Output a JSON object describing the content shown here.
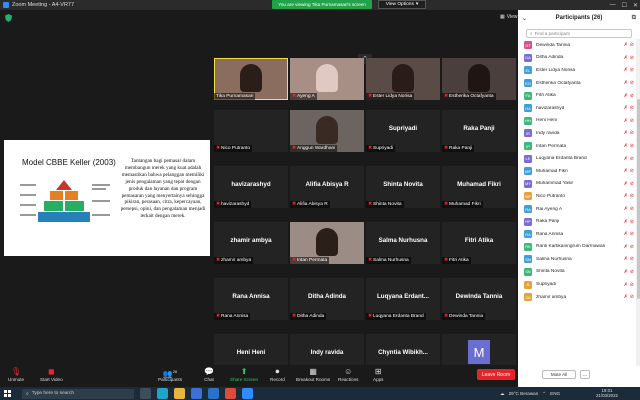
{
  "window": {
    "title": "Zoom Meeting - A4-VR77",
    "share_banner": "You are viewing Tika Purnamasari's screen",
    "view_options": "View Options",
    "minimize": "—",
    "maximize": "☐",
    "close": "✕"
  },
  "meeting": {
    "view_label": "View",
    "up_arrow": "⌃"
  },
  "slide": {
    "title": "Model CBBE Keller (2003)",
    "text": "Tantangan bagi pemasar dalam membangun merek yang kuat adalah memastikan bahwa pelanggan memiliki jenis pengalaman yang tepat dengan produk dan layanan dan program pemasaran yang menyertainya sehingga pikiran, perasaan, citra, kepercayaan, persepsi, opini, dan pengalaman menjadi terkait dengan merek."
  },
  "gallery": {
    "tiles": [
      {
        "name": "Tika Purnamasari",
        "center": "",
        "video": true,
        "muted": false
      },
      {
        "name": "Ayeng A",
        "center": "",
        "video": true,
        "muted": true
      },
      {
        "name": "Ester Lidya Norisa",
        "center": "",
        "video": true,
        "muted": true
      },
      {
        "name": "Estherika Octafyanta",
        "center": "",
        "video": true,
        "muted": true
      },
      {
        "name": "Nico Putranto",
        "center": "",
        "video": false,
        "muted": true
      },
      {
        "name": "Anggun Wardhani",
        "center": "",
        "video": true,
        "muted": true
      },
      {
        "name": "Supriyadi",
        "center": "Supriyadi",
        "video": false,
        "muted": true
      },
      {
        "name": "Raka Panji",
        "center": "Raka Panji",
        "video": false,
        "muted": true
      },
      {
        "name": "havizarashyd",
        "center": "havizarashyd",
        "video": false,
        "muted": true
      },
      {
        "name": "Alifia Abisya R",
        "center": "Alifia Abisya R",
        "video": false,
        "muted": true
      },
      {
        "name": "Shinta Novita",
        "center": "Shinta Novita",
        "video": false,
        "muted": true
      },
      {
        "name": "Muhamad Fikri",
        "center": "Muhamad Fikri",
        "video": false,
        "muted": true
      },
      {
        "name": "zhamir ambya",
        "center": "zhamir ambya",
        "video": false,
        "muted": true
      },
      {
        "name": "Intan Permata",
        "center": "",
        "video": true,
        "muted": true
      },
      {
        "name": "Salma Nurhusna",
        "center": "Salma Nurhusna",
        "video": false,
        "muted": true
      },
      {
        "name": "Fitri Atika",
        "center": "Fitri Atika",
        "video": false,
        "muted": true
      },
      {
        "name": "Rana Annisa",
        "center": "Rana Annisa",
        "video": false,
        "muted": true
      },
      {
        "name": "Ditha Adinda",
        "center": "Ditha Adinda",
        "video": false,
        "muted": true
      },
      {
        "name": "Luqyana Erdanta Brand",
        "center": "Luqyana Erdant...",
        "video": false,
        "muted": true
      },
      {
        "name": "Dewinda Tannia",
        "center": "Dewinda Tannia",
        "video": false,
        "muted": true
      },
      {
        "name": "Heni Heni",
        "center": "Heni Heni",
        "video": false,
        "muted": true
      },
      {
        "name": "Indy ravida",
        "center": "Indy ravida",
        "video": false,
        "muted": true
      },
      {
        "name": "Chyntia Wibikhansa",
        "center": "Chyntia Wibikh...",
        "video": false,
        "muted": true
      },
      {
        "name": "Muhammad Yasir",
        "center": "",
        "video": false,
        "muted": true,
        "avatar": "M"
      }
    ]
  },
  "toolbar": {
    "unmute": "Unmute",
    "start_video": "Start Video",
    "participants": "Participants",
    "participants_count": "26",
    "chat": "Chat",
    "share_screen": "Share Screen",
    "record": "Record",
    "breakout": "Breakout Rooms",
    "reactions": "Reactions",
    "apps": "Apps",
    "leave": "Leave Room"
  },
  "panel": {
    "title": "Participants (26)",
    "search_placeholder": "Find a participant",
    "mute_all": "Mute All",
    "more": "...",
    "participants": [
      {
        "initials": "DT",
        "name": "Dewinda Tannia",
        "color": "#d94f8c"
      },
      {
        "initials": "DA",
        "name": "Ditha Adinda",
        "color": "#7a6bd6"
      },
      {
        "initials": "EL",
        "name": "Ester Lidya Norisa",
        "color": "#3fa0d8"
      },
      {
        "initials": "EO",
        "name": "Estherika Octafyanta",
        "color": "#3fa0d8"
      },
      {
        "initials": "FA",
        "name": "Fitri Atika",
        "color": "#3cb878"
      },
      {
        "initials": "HA",
        "name": "havizarashyd",
        "color": "#3fa0d8"
      },
      {
        "initials": "HH",
        "name": "Heni Heni",
        "color": "#3cb878"
      },
      {
        "initials": "IR",
        "name": "Indy ravida",
        "color": "#7a6bd6"
      },
      {
        "initials": "IP",
        "name": "Intan Permata",
        "color": "#3cb878"
      },
      {
        "initials": "LE",
        "name": "Luqyana Erdanta Brand",
        "color": "#7a6bd6"
      },
      {
        "initials": "MF",
        "name": "Muhamad Fikri",
        "color": "#3fa0d8"
      },
      {
        "initials": "MY",
        "name": "Muhammad Yasir",
        "color": "#7a6bd6"
      },
      {
        "initials": "NP",
        "name": "Nico Putranto",
        "color": "#e8a23a"
      },
      {
        "initials": "RA",
        "name": "Rai Ayeng A",
        "color": "#3fa0d8"
      },
      {
        "initials": "RP",
        "name": "Raka Panji",
        "color": "#7a6bd6"
      },
      {
        "initials": "RA",
        "name": "Rana Annisa",
        "color": "#3fa0d8"
      },
      {
        "initials": "RK",
        "name": "Ranti Kartikaningrum Darmawan",
        "color": "#3cb878"
      },
      {
        "initials": "SN",
        "name": "Salma Nurhusna",
        "color": "#3fa0d8"
      },
      {
        "initials": "SN",
        "name": "Shinta Novita",
        "color": "#3cb878"
      },
      {
        "initials": "S",
        "name": "Supriyadi",
        "color": "#e8a23a"
      },
      {
        "initials": "ZA",
        "name": "zhamir ambya",
        "color": "#e8a23a"
      }
    ]
  },
  "taskbar": {
    "search": "Type here to search",
    "weather": "29°C Berawan",
    "time": "19:01",
    "date": "21/03/2022",
    "language": "ENG"
  }
}
